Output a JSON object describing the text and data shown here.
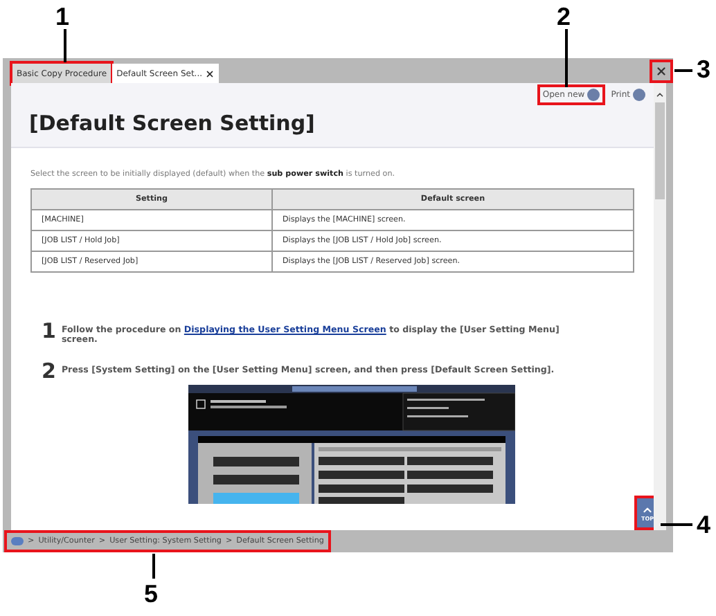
{
  "tabs": [
    {
      "label": "Basic Copy Procedure",
      "selected": false,
      "closable": false
    },
    {
      "label": "Default Screen Set...",
      "selected": true,
      "closable": true
    }
  ],
  "toolbar": {
    "open_new": "Open new",
    "print": "Print"
  },
  "title": "[Default Screen Setting]",
  "intro": "Select the screen to be initially displayed (default) when the **sub power switch** is turned on.",
  "table": {
    "columns": [
      "Setting",
      "Default screen"
    ],
    "rows": [
      [
        "[MACHINE]",
        "Displays the [MACHINE] screen."
      ],
      [
        "[JOB LIST / Hold Job]",
        "Displays the [JOB LIST / Hold Job] screen."
      ],
      [
        "[JOB LIST / Reserved Job]",
        "Displays the [JOB LIST / Reserved Job] screen."
      ]
    ]
  },
  "steps": [
    {
      "number": "1",
      "before": "Follow the procedure on ",
      "link": "Displaying the User Setting Menu Screen",
      "after": " to display the [User Setting Menu] screen."
    },
    {
      "number": "2",
      "before": "Press [System Setting] on the [User Setting Menu] screen, and then press [Default Screen Setting]."
    }
  ],
  "top_button": "TOP",
  "breadcrumb": {
    "separator": ">",
    "items": [
      "Utility/Counter",
      "User Setting: System Setting",
      "Default Screen Setting"
    ]
  },
  "callouts": [
    {
      "label": "1"
    },
    {
      "label": "2"
    },
    {
      "label": "3"
    },
    {
      "label": "4"
    },
    {
      "label": "5"
    }
  ]
}
